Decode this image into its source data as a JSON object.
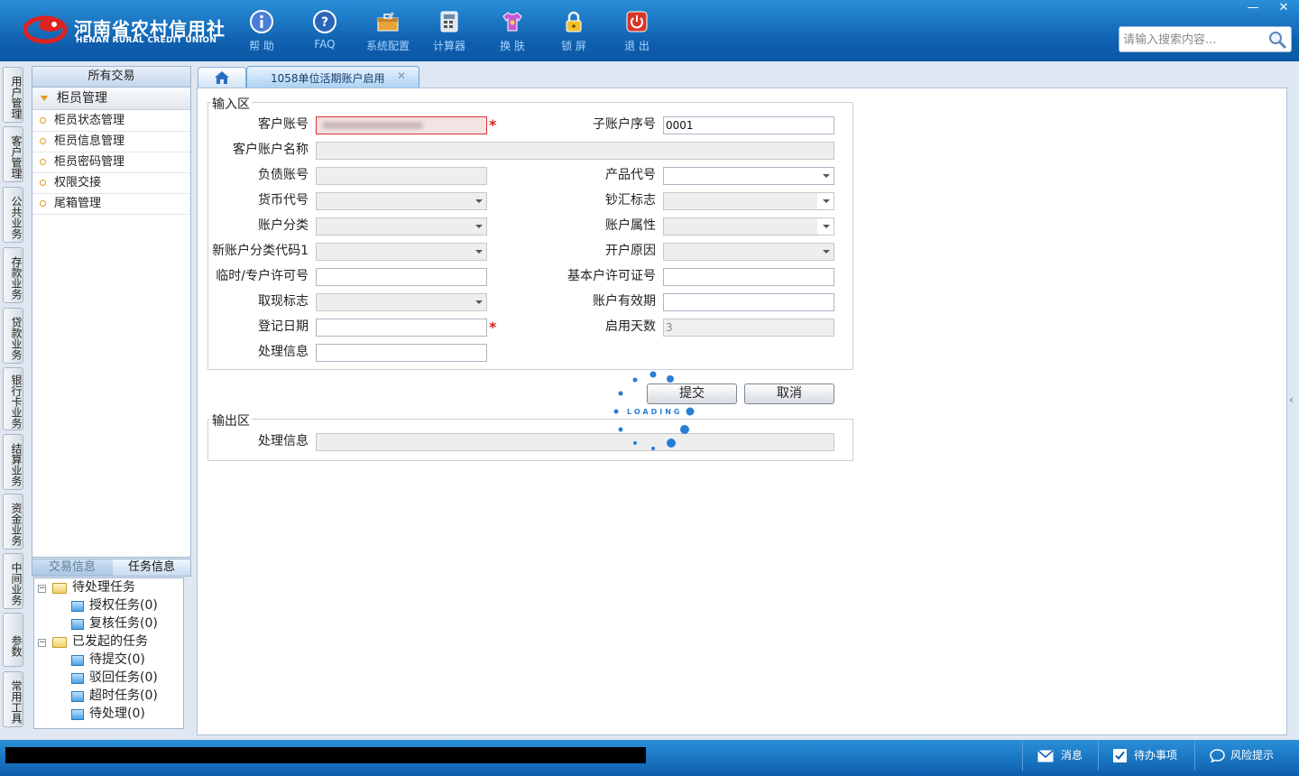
{
  "header": {
    "logo_cn": "河南省农村信用社",
    "logo_en": "HENAN RURAL CREDIT UNION",
    "toolbar": [
      {
        "key": "help",
        "label": "帮 助",
        "icon": "info-icon"
      },
      {
        "key": "faq",
        "label": "FAQ",
        "icon": "question-icon"
      },
      {
        "key": "config",
        "label": "系统配置",
        "icon": "toolbox-icon"
      },
      {
        "key": "calc",
        "label": "计算器",
        "icon": "calculator-icon"
      },
      {
        "key": "skin",
        "label": "换 肤",
        "icon": "shirt-icon"
      },
      {
        "key": "lock",
        "label": "锁 屏",
        "icon": "lock-icon"
      },
      {
        "key": "exit",
        "label": "退 出",
        "icon": "power-icon"
      }
    ],
    "window": {
      "minimize": "—",
      "close": "✕"
    },
    "search_placeholder": "请输入搜索内容..."
  },
  "categories": [
    "用户管理",
    "客户管理",
    "公共业务",
    "存款业务",
    "贷款业务",
    "银行卡业务",
    "结算业务",
    "资金业务",
    "中间业务",
    "参数",
    "常用工具"
  ],
  "menu": {
    "title": "所有交易",
    "group": "柜员管理",
    "items": [
      "柜员状态管理",
      "柜员信息管理",
      "柜员密码管理",
      "权限交接",
      "尾箱管理"
    ]
  },
  "tasks": {
    "tabs": [
      "交易信息",
      "任务信息"
    ],
    "active_tab": "任务信息",
    "groups": [
      {
        "label": "待处理任务",
        "children": [
          "授权任务(0)",
          "复核任务(0)"
        ]
      },
      {
        "label": "已发起的任务",
        "children": [
          "待提交(0)",
          "驳回任务(0)",
          "超时任务(0)",
          "待处理(0)"
        ]
      }
    ]
  },
  "tabs": {
    "active_label": "1058单位活期账户启用",
    "close": "✕"
  },
  "input_section": {
    "legend": "输入区",
    "labels": {
      "customer_account": "客户账号",
      "sub_account_no": "子账户序号",
      "customer_account_name": "客户账户名称",
      "liability_account": "负债账号",
      "product_code": "产品代号",
      "currency_code": "货币代号",
      "cash_remit_flag": "钞汇标志",
      "account_category": "账户分类",
      "account_attribute": "账户属性",
      "new_category_code": "新账户分类代码1",
      "open_reason": "开户原因",
      "temp_license": "临时/专户许可号",
      "basic_license": "基本户许可证号",
      "withdraw_flag": "取现标志",
      "account_validity": "账户有效期",
      "register_date": "登记日期",
      "enable_days": "启用天数",
      "process_info": "处理信息"
    },
    "values": {
      "sub_account_no": "0001",
      "enable_days": "3"
    },
    "required_mark": "*"
  },
  "buttons": {
    "submit": "提交",
    "cancel": "取消"
  },
  "loading_text": "LOADING",
  "output_section": {
    "legend": "输出区",
    "process_info_label": "处理信息"
  },
  "status_bar": {
    "message": "消息",
    "todo": "待办事项",
    "risk": "风险提示"
  },
  "colors": {
    "header_blue": "#0f5fae",
    "required_red": "#d22222",
    "accent_orange": "#e69a14"
  }
}
